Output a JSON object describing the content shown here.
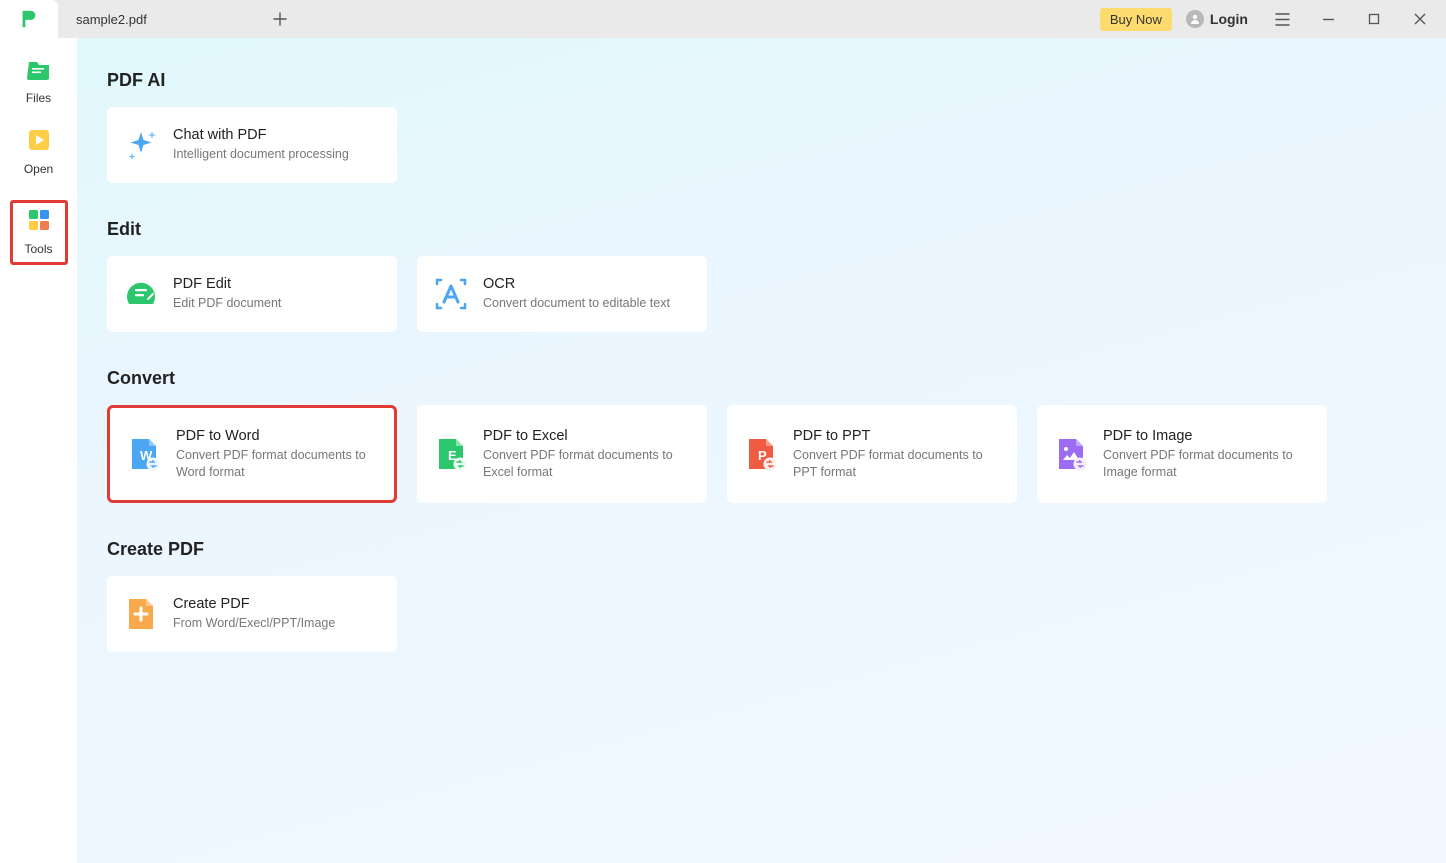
{
  "titlebar": {
    "tab_label": "sample2.pdf",
    "buy_now": "Buy Now",
    "login": "Login"
  },
  "sidebar": {
    "items": [
      {
        "label": "Files"
      },
      {
        "label": "Open"
      },
      {
        "label": "Tools"
      }
    ]
  },
  "sections": {
    "pdf_ai": {
      "heading": "PDF AI",
      "cards": [
        {
          "title": "Chat with PDF",
          "desc": "Intelligent document processing"
        }
      ]
    },
    "edit": {
      "heading": "Edit",
      "cards": [
        {
          "title": "PDF Edit",
          "desc": "Edit PDF document"
        },
        {
          "title": "OCR",
          "desc": "Convert document to editable text"
        }
      ]
    },
    "convert": {
      "heading": "Convert",
      "cards": [
        {
          "title": "PDF to Word",
          "desc": "Convert PDF format documents to Word format"
        },
        {
          "title": "PDF to Excel",
          "desc": "Convert PDF format documents to Excel format"
        },
        {
          "title": "PDF to PPT",
          "desc": "Convert PDF format documents to PPT format"
        },
        {
          "title": "PDF to Image",
          "desc": "Convert PDF format documents to Image format"
        }
      ]
    },
    "create": {
      "heading": "Create PDF",
      "cards": [
        {
          "title": "Create PDF",
          "desc": "From Word/Execl/PPT/Image"
        }
      ]
    }
  }
}
